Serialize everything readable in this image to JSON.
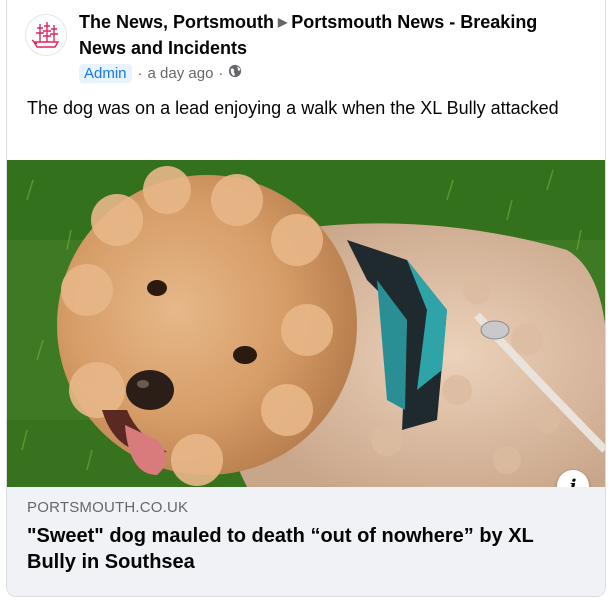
{
  "post": {
    "author": "The News, Portsmouth",
    "group": "Portsmouth News - Breaking News and Incidents",
    "badge": "Admin",
    "time": "a day ago",
    "separator": "·",
    "text": "The dog was on a lead enjoying a walk when the XL Bully attacked"
  },
  "link": {
    "domain": "PORTSMOUTH.CO.UK",
    "headline": "\"Sweet\" dog mauled to death “out of nowhere” by XL Bully in Southsea"
  },
  "icons": {
    "avatar": "ship-logo-icon",
    "arrow": "triangle-right-icon",
    "privacy": "globe-icon",
    "info": "info-icon"
  },
  "colors": {
    "accent": "#1877f2",
    "badge_bg": "#e7f3ff",
    "logo": "#e0245e",
    "link_bg": "#f0f2f5",
    "muted": "#65676b"
  }
}
